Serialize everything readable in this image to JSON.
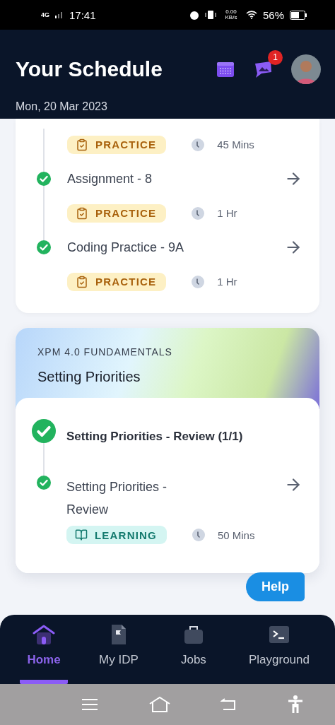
{
  "status_bar": {
    "network": "4G",
    "time": "17:41",
    "data_speed": "0.00 KB/s",
    "battery": "56%"
  },
  "header": {
    "title": "Your Schedule",
    "date": "Mon, 20 Mar 2023",
    "notification_count": "1"
  },
  "schedule_items": [
    {
      "tag": {
        "kind": "practice",
        "label": "PRACTICE"
      },
      "duration": "45 Mins"
    },
    {
      "title": "Assignment - 8",
      "completed": true,
      "tag": {
        "kind": "practice",
        "label": "PRACTICE"
      },
      "duration": "1 Hr"
    },
    {
      "title": "Coding Practice - 9A",
      "completed": true,
      "tag": {
        "kind": "practice",
        "label": "PRACTICE"
      },
      "duration": "1 Hr"
    }
  ],
  "course": {
    "category": "XPM 4.0 FUNDAMENTALS",
    "title": "Setting Priorities",
    "module": {
      "title": "Setting Priorities - Review (1/1)",
      "completed": true
    },
    "items": [
      {
        "title": "Setting Priorities - Review",
        "completed": true,
        "tag": {
          "kind": "learning",
          "label": "LEARNING"
        },
        "duration": "50 Mins"
      }
    ]
  },
  "help_button": "Help",
  "bottom_nav": [
    {
      "label": "Home",
      "kind": "home",
      "selected": true
    },
    {
      "label": "My IDP",
      "kind": "document",
      "selected": false
    },
    {
      "label": "Jobs",
      "kind": "bag",
      "selected": false
    },
    {
      "label": "Playground",
      "kind": "terminal",
      "selected": false
    }
  ]
}
